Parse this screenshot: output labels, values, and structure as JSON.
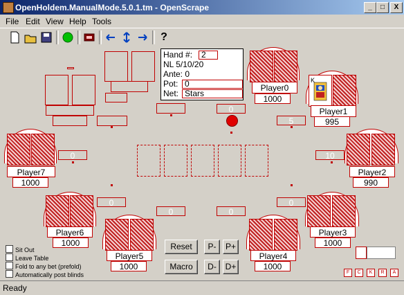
{
  "window": {
    "title": "OpenHoldem.ManualMode.5.0.1.tm - OpenScrape",
    "minimize": "_",
    "maximize": "□",
    "close": "X"
  },
  "menu": [
    "File",
    "Edit",
    "View",
    "Help",
    "Tools"
  ],
  "toolbar": {
    "icons": [
      "new-icon",
      "open-icon",
      "save-icon",
      "green-circle-icon",
      "red-box-icon",
      "arrow-left-icon",
      "arrow-updown-icon",
      "arrow-right-icon",
      "help-icon"
    ],
    "help_label": "?"
  },
  "info": {
    "hand_label": "Hand #:",
    "hand_value": "2",
    "limits": "NL 5/10/20",
    "ante": "Ante: 0",
    "pot_label": "Pot:",
    "pot_value": "0",
    "net_label": "Net:",
    "net_value": "Stars"
  },
  "players": [
    {
      "name": "Player0",
      "balance": "1000"
    },
    {
      "name": "Player1",
      "balance": "995"
    },
    {
      "name": "Player2",
      "balance": "990"
    },
    {
      "name": "Player3",
      "balance": "1000"
    },
    {
      "name": "Player4",
      "balance": "1000"
    },
    {
      "name": "Player5",
      "balance": "1000"
    },
    {
      "name": "Player6",
      "balance": "1000"
    },
    {
      "name": "Player7",
      "balance": "1000"
    }
  ],
  "bets": {
    "b0": "0",
    "b1": "5",
    "b2": "10",
    "b3": "0",
    "b4": "0",
    "b5": "0",
    "b6": "0",
    "b7": "0"
  },
  "buttons": {
    "reset": "Reset",
    "macro": "Macro",
    "p_minus": "P-",
    "p_plus": "P+",
    "d_minus": "D-",
    "d_plus": "D+"
  },
  "checkboxes": [
    "Sit Out",
    "Leave Table",
    "Fold to any bet (prefold)",
    "Automatically post blinds"
  ],
  "mini_buttons": [
    "F",
    "C",
    "K",
    "R",
    "A"
  ],
  "status": "Ready",
  "colors": {
    "accent": "#c00000",
    "dealer": "#e00000",
    "titlebar": "#0a246a"
  }
}
